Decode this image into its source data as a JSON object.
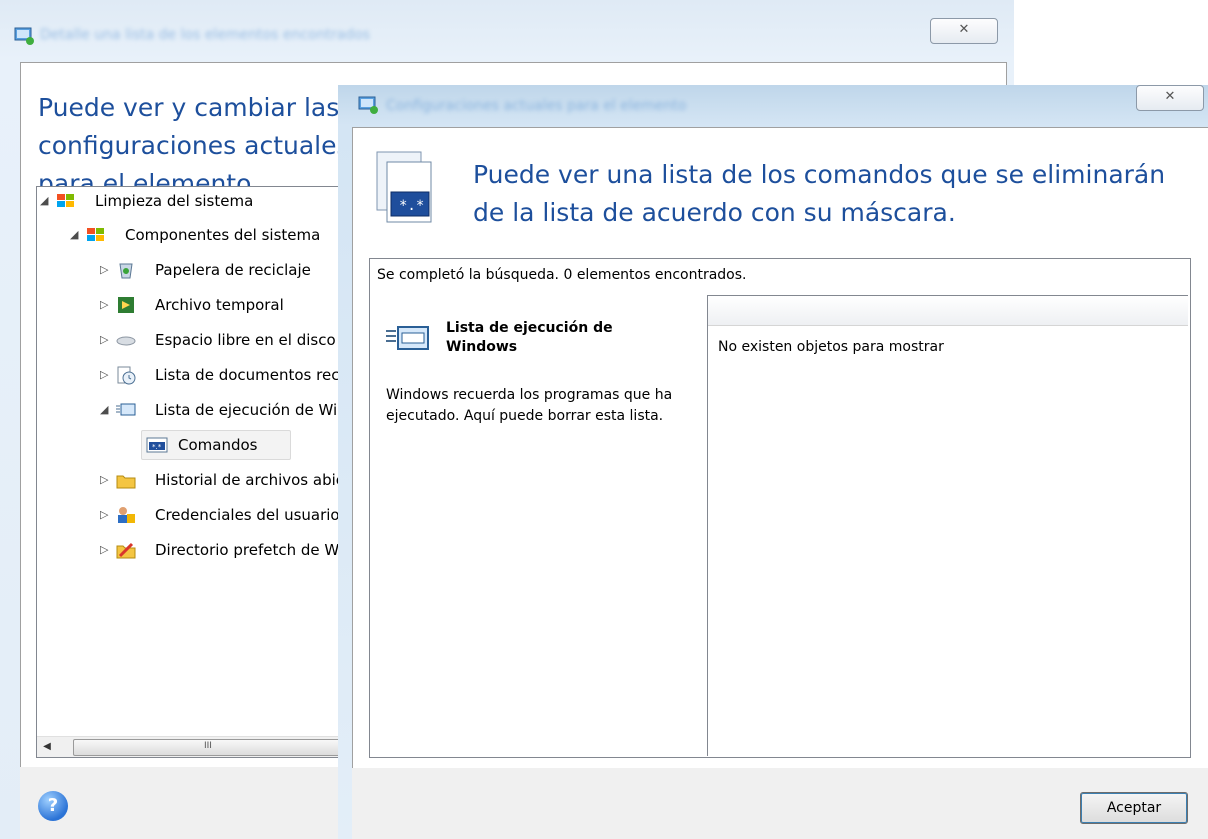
{
  "back_window": {
    "heading": "Puede ver y cambiar las configuraciones actuales para el elemento seleccionado.",
    "close_label": "✕",
    "tree": [
      {
        "label": "Limpieza del sistema",
        "icon": "system-cleanup-icon",
        "expanded": true
      },
      {
        "label": "Componentes del sistema",
        "icon": "system-components-icon",
        "expanded": true
      },
      {
        "label": "Papelera de reciclaje",
        "icon": "recycle-bin-icon"
      },
      {
        "label": "Archivo temporal",
        "icon": "temp-files-icon"
      },
      {
        "label": "Espacio libre en el disco",
        "icon": "free-disk-space-icon"
      },
      {
        "label": "Lista de documentos recientes",
        "icon": "recent-documents-icon"
      },
      {
        "label": "Lista de ejecución de Windows",
        "icon": "run-list-icon",
        "expanded": true
      },
      {
        "label": "Comandos",
        "icon": "commands-icon",
        "selected": true
      },
      {
        "label": "Historial de archivos abiertos",
        "icon": "open-files-history-icon"
      },
      {
        "label": "Credenciales del usuario",
        "icon": "user-credentials-icon"
      },
      {
        "label": "Directorio prefetch de Windows",
        "icon": "prefetch-directory-icon"
      }
    ],
    "scroll_grip": "III"
  },
  "dialog": {
    "close_label": "✕",
    "heading": "Puede ver una lista de los comandos que se eliminarán de la lista de acuerdo con su máscara.",
    "status": "Se completó la búsqueda. 0 elementos encontrados.",
    "item_title": "Lista de ejecución de Windows",
    "item_description": "Windows recuerda los programas que ha ejecutado. Aquí puede borrar esta lista.",
    "empty_message": "No existen objetos para mostrar",
    "ok_label": "Aceptar"
  }
}
